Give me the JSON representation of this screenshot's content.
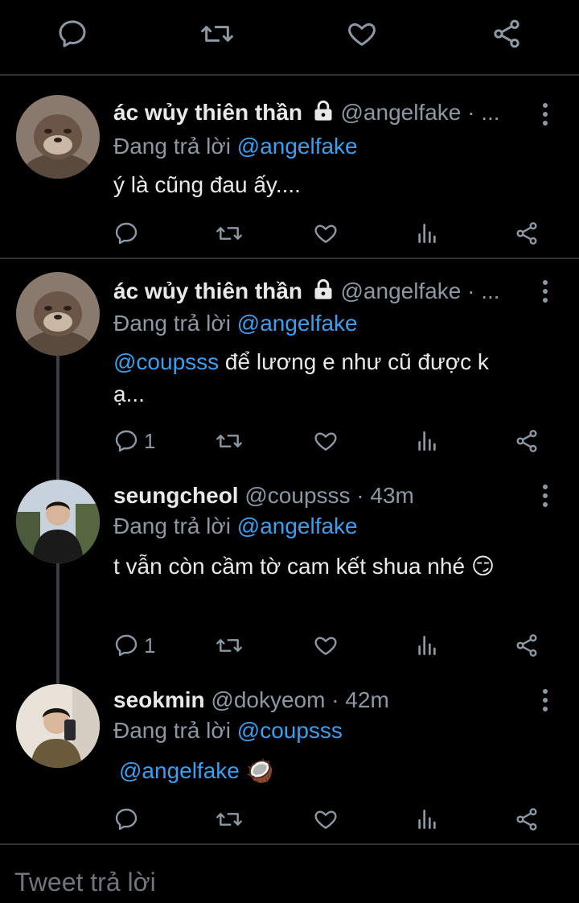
{
  "icons": {
    "reply": "reply-icon",
    "retweet": "retweet-icon",
    "like": "heart-icon",
    "share": "share-icon",
    "analytics": "analytics-icon",
    "more": "more-vertical-icon",
    "lock": "lock-icon"
  },
  "colors": {
    "background": "#000000",
    "text": "#e7e9ea",
    "muted": "#8b98a5",
    "mention": "#3a9ff0",
    "divider": "#2f3336"
  },
  "tweets": [
    {
      "display_name": "ác wủy thiên thần",
      "handle": "@angelfake · ...",
      "replying_prefix": "Đang trả lời ",
      "replying_to": "@angelfake",
      "text": "ý là cũng đau ấy....",
      "reply_count": ""
    },
    {
      "display_name": "ác wủy thiên thần",
      "handle": "@angelfake · ...",
      "replying_prefix": "Đang trả lời ",
      "replying_to": "@angelfake",
      "mention": "@coupsss",
      "text_after_mention": " để lương e như cũ được k",
      "text_line2": "ạ...",
      "reply_count": "1"
    },
    {
      "display_name": "seungcheol",
      "handle": "@coupsss · 43m",
      "replying_prefix": "Đang trả lời ",
      "replying_to": "@angelfake",
      "text": "t vẫn còn cầm tờ cam kết shua nhé",
      "emoji": "😏",
      "reply_count": "1"
    },
    {
      "display_name": "seokmin",
      "handle": "@dokyeom · 42m",
      "replying_prefix": "Đang trả lời ",
      "replying_to": "@coupsss",
      "mention": "@angelfake",
      "emoji": "🥥",
      "reply_count": ""
    }
  ],
  "reply_box": {
    "placeholder": "Tweet trả lời"
  }
}
